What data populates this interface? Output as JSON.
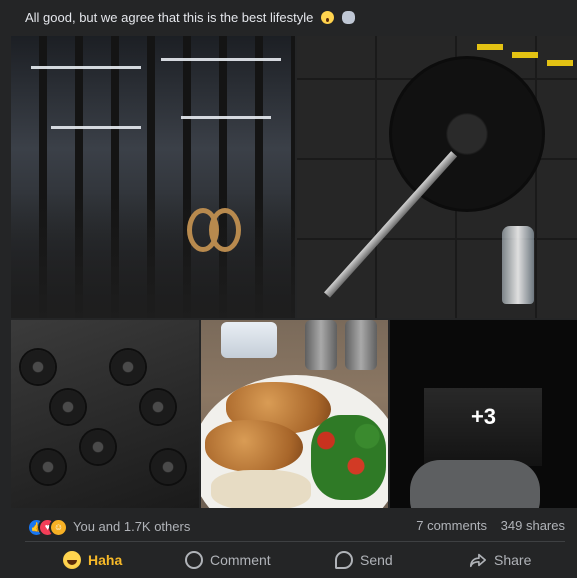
{
  "post": {
    "caption": "All good, but we agree that this is the best lifestyle"
  },
  "gallery": {
    "tiles": [
      {
        "subject": "gym interior with racks and gymnastic rings"
      },
      {
        "subject": "barbell with black plates and water bottle"
      },
      {
        "subject": "rack of dumbbells"
      },
      {
        "subject": "plate of chicken, salad and rice"
      },
      {
        "subject": "room with screen and game controller"
      }
    ],
    "more_count": "+3"
  },
  "engagement": {
    "reactions_text": "You and 1.7K others",
    "comments": "7 comments",
    "shares": "349 shares",
    "reaction_icons": [
      "like-icon",
      "love-icon",
      "haha-icon"
    ]
  },
  "actions": {
    "haha": "Haha",
    "comment": "Comment",
    "send": "Send",
    "share": "Share"
  },
  "colors": {
    "background": "#242526",
    "active_reaction": "#f7b928",
    "muted_text": "#b0b3b8",
    "like": "#1877f2",
    "love": "#f33e58"
  }
}
